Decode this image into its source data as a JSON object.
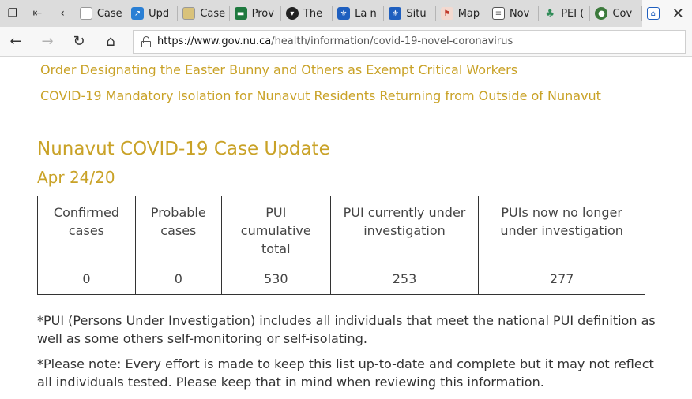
{
  "browser": {
    "tabs": [
      {
        "label": "Case",
        "icon": "document-icon",
        "color": "#ffffff"
      },
      {
        "label": "Upd",
        "icon": "chart-icon",
        "color": "#2a7fd4"
      },
      {
        "label": "Case",
        "icon": "document-icon",
        "color": "#d9c27a"
      },
      {
        "label": "Prov",
        "icon": "flag-icon",
        "color": "#1f7a3f"
      },
      {
        "label": "The",
        "icon": "shield-icon",
        "color": "#222222"
      },
      {
        "label": "La n",
        "icon": "fleur-de-lis-icon",
        "color": "#1f5fbf"
      },
      {
        "label": "Situ",
        "icon": "fleur-de-lis-icon",
        "color": "#1f5fbf"
      },
      {
        "label": "Map",
        "icon": "map-icon",
        "color": "#c0392b"
      },
      {
        "label": "Nov",
        "icon": "document-icon",
        "color": "#555555"
      },
      {
        "label": "PEI (",
        "icon": "tree-icon",
        "color": "#2e8b57"
      },
      {
        "label": "Cov",
        "icon": "globe-icon",
        "color": "#3c7a3c"
      }
    ],
    "active_tab_icon": "nunavut-icon",
    "url_host": "https://www.gov.nu.ca",
    "url_path": "/health/information/covid-19-novel-coronavirus"
  },
  "page": {
    "links": [
      "Order Designating the Easter Bunny and Others as Exempt Critical Workers",
      "COVID-19 Mandatory Isolation for Nunavut Residents Returning from Outside of Nunavut"
    ],
    "heading": "Nunavut COVID-19 Case Update",
    "date": "Apr 24/20",
    "table": {
      "headers": [
        "Confirmed cases",
        "Probable cases",
        "PUI cumulative total",
        "PUI currently under investigation",
        "PUIs now no longer under investigation"
      ],
      "values": [
        "0",
        "0",
        "530",
        "253",
        "277"
      ]
    },
    "notes": [
      "*PUI (Persons Under Investigation) includes all individuals that meet the national PUI definition as well as some others self-monitoring or self-isolating.",
      "*Please note: Every effort is made to keep this list up-to-date and complete but it may not reflect all individuals tested. Please keep that in mind when reviewing this information."
    ],
    "accent_color": "#c9a227"
  }
}
